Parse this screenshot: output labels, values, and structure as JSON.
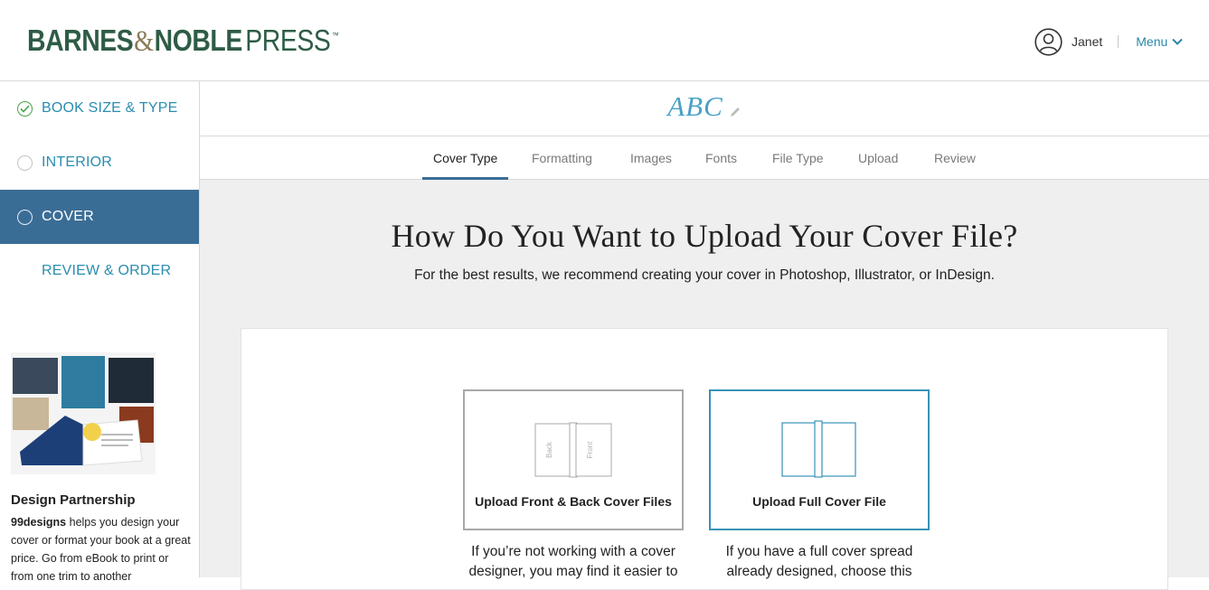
{
  "header": {
    "logo": {
      "part1": "BARNES",
      "amp": "&",
      "part2": "NOBLE",
      "part3": "PRESS",
      "tm": "™"
    },
    "user_name": "Janet",
    "menu_label": "Menu"
  },
  "sidebar": {
    "steps": [
      {
        "label": "BOOK SIZE & TYPE",
        "status": "done"
      },
      {
        "label": "INTERIOR",
        "status": "pending"
      },
      {
        "label": "COVER",
        "status": "active"
      },
      {
        "label": "REVIEW & ORDER",
        "status": "none"
      }
    ],
    "promo": {
      "title": "Design Partnership",
      "brand": "99designs",
      "text": "helps you design your cover or format your book at a great price. Go from eBook to print or from one trim to another"
    }
  },
  "book": {
    "title": "ABC"
  },
  "tabs": [
    {
      "label": "Cover Type",
      "active": true
    },
    {
      "label": "Formatting"
    },
    {
      "label": "Images"
    },
    {
      "label": "Fonts"
    },
    {
      "label": "File Type"
    },
    {
      "label": "Upload"
    },
    {
      "label": "Review"
    }
  ],
  "main": {
    "heading": "How Do You Want to Upload Your Cover File?",
    "subheading": "For the best results, we recommend creating your cover in Photoshop, Illustrator, or InDesign.",
    "options": [
      {
        "label": "Upload Front & Back Cover Files",
        "back_text": "Back",
        "front_text": "Front",
        "description": "If you’re not working with a cover designer, you may find it easier to",
        "selected": false
      },
      {
        "label": "Upload Full Cover File",
        "description": "If you have a full cover spread already designed, choose this",
        "selected": true
      }
    ]
  },
  "colors": {
    "brand_green": "#2e5c46",
    "link_blue": "#2a8db0",
    "active_step_bg": "#3a6d96",
    "selected_border": "#3793b8",
    "check_green": "#47a34a"
  },
  "icons": {
    "avatar": "user-circle-icon",
    "menu": "chevron-down-icon",
    "edit": "pencil-icon",
    "step_done": "check-circle-icon",
    "step_pending": "empty-circle-icon"
  }
}
